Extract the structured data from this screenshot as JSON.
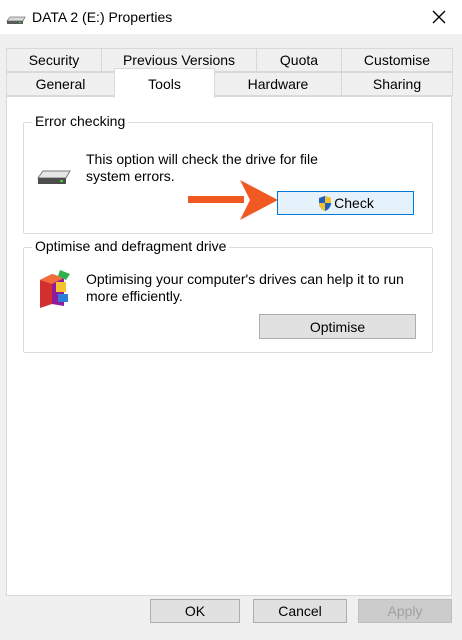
{
  "window": {
    "title": "DATA 2 (E:) Properties",
    "close_icon": "close-icon",
    "drive_icon": "drive-icon"
  },
  "tabs": {
    "row1": [
      "Security",
      "Previous Versions",
      "Quota",
      "Customise"
    ],
    "row2": [
      "General",
      "Tools",
      "Hardware",
      "Sharing"
    ],
    "active": "Tools"
  },
  "error_checking": {
    "title": "Error checking",
    "description_line1": "This option will check the drive for file",
    "description_line2": "system errors.",
    "button_label": "Check",
    "button_icon": "uac-shield-icon",
    "annotation_icon": "orange-arrow-icon"
  },
  "optimise": {
    "title": "Optimise and defragment drive",
    "description_line1": "Optimising your computer's drives can help it to run",
    "description_line2": "more efficiently.",
    "button_label": "Optimise"
  },
  "footer": {
    "ok_label": "OK",
    "cancel_label": "Cancel",
    "apply_label": "Apply"
  },
  "colors": {
    "arrow": "#f05a22",
    "focus_border": "#0078d7",
    "focus_fill": "#e5f1fb"
  }
}
